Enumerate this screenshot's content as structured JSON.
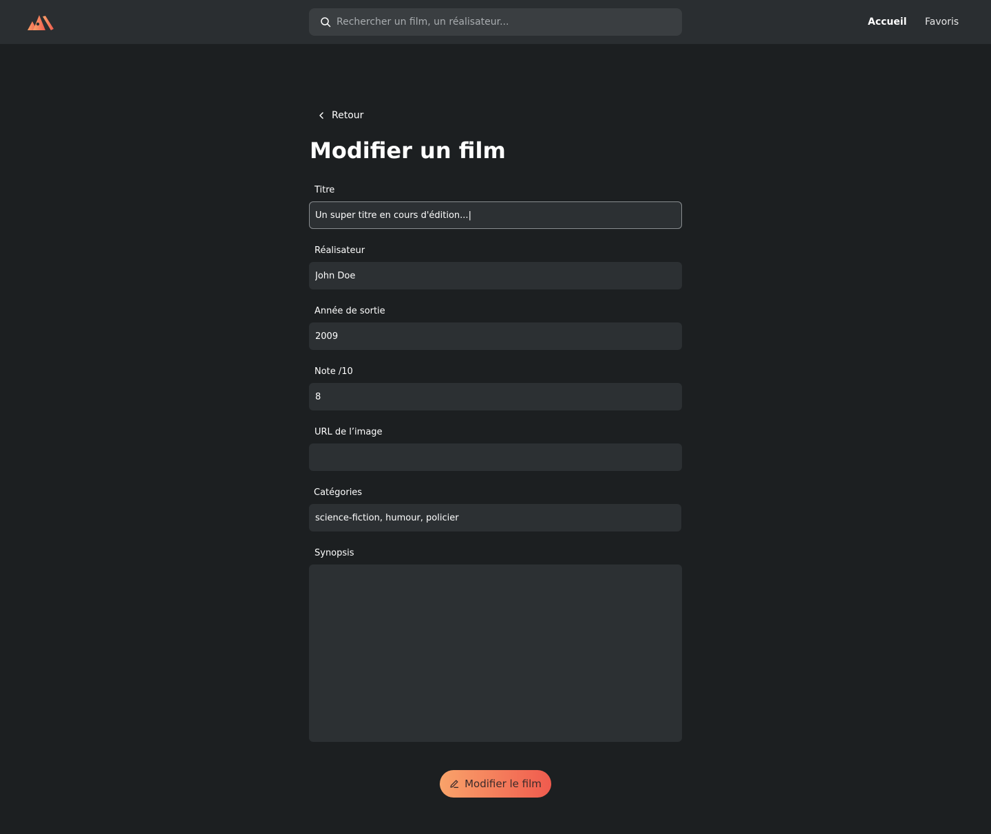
{
  "header": {
    "search_placeholder": "Rechercher un film, un réalisateur...",
    "nav": {
      "home": "Accueil",
      "favorites": "Favoris"
    }
  },
  "main": {
    "back_label": "Retour",
    "title": "Modifier un film",
    "fields": {
      "title": {
        "label": "Titre",
        "value": "Un super titre en cours d'édition...|"
      },
      "director": {
        "label": "Réalisateur",
        "value": "John Doe"
      },
      "year": {
        "label": "Année de sortie",
        "value": "2009"
      },
      "rating": {
        "label": "Note /10",
        "value": "8"
      },
      "image_url": {
        "label": "URL de l’image",
        "value": ""
      },
      "categories": {
        "label": "Catégories",
        "value": "science-fiction, humour, policier"
      },
      "synopsis": {
        "label": "Synopsis",
        "value": ""
      }
    },
    "submit_label": "Modifier le film"
  },
  "icons": {
    "logo": "logo-icon",
    "search": "search-icon",
    "back": "chevron-left-icon",
    "submit": "pencil-icon"
  },
  "colors": {
    "accent_start": "#f9a36a",
    "accent_end": "#f05b4e",
    "background": "#1c1f21",
    "topbar": "#2a2e31"
  }
}
